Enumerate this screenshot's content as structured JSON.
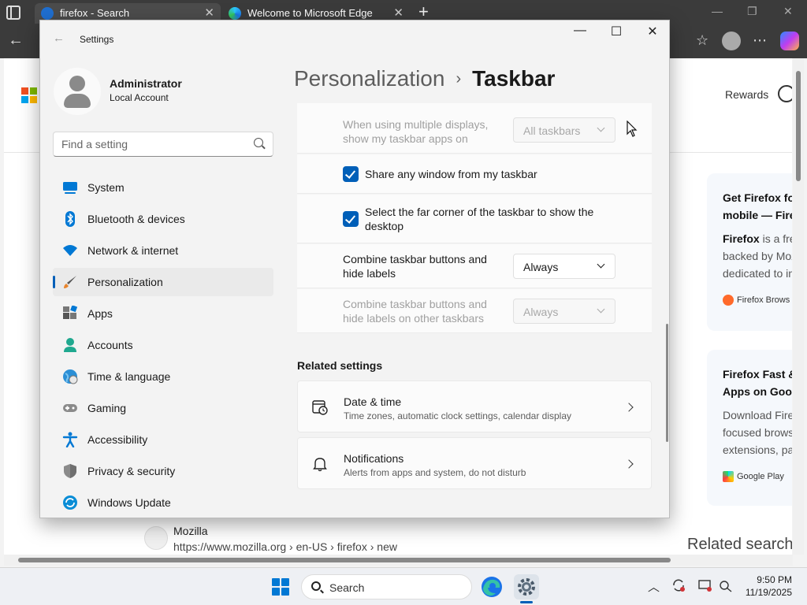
{
  "browser": {
    "tabs": [
      {
        "title": "firefox - Search",
        "active": true
      },
      {
        "title": "Welcome to Microsoft Edge",
        "active": false
      }
    ],
    "new_tab": "+",
    "rewards": "Rewards",
    "cards": [
      {
        "title_lines": [
          "Get Firefox for",
          "mobile — Firef"
        ],
        "body_bold": "Firefox",
        "body_lines": [
          " is a fre",
          "backed by Moz",
          "dedicated to in"
        ],
        "source": "Firefox Brows"
      },
      {
        "title_lines": [
          "Firefox Fast &",
          "Apps on Goog"
        ],
        "body_lines": [
          "Download Fire",
          "focused brows",
          "extensions, pa"
        ],
        "source": "Google Play"
      }
    ],
    "result": {
      "title": "Mozilla",
      "url": "https://www.mozilla.org › en-US › firefox › new"
    },
    "related_searches": "Related search"
  },
  "settings": {
    "window_title": "Settings",
    "account": {
      "name": "Administrator",
      "type": "Local Account"
    },
    "search_placeholder": "Find a setting",
    "nav": [
      {
        "label": "System",
        "icon": "system-icon",
        "active": false
      },
      {
        "label": "Bluetooth & devices",
        "icon": "bluetooth-icon",
        "active": false
      },
      {
        "label": "Network & internet",
        "icon": "wifi-icon",
        "active": false
      },
      {
        "label": "Personalization",
        "icon": "brush-icon",
        "active": true
      },
      {
        "label": "Apps",
        "icon": "apps-icon",
        "active": false
      },
      {
        "label": "Accounts",
        "icon": "accounts-icon",
        "active": false
      },
      {
        "label": "Time & language",
        "icon": "globe-icon",
        "active": false
      },
      {
        "label": "Gaming",
        "icon": "gamepad-icon",
        "active": false
      },
      {
        "label": "Accessibility",
        "icon": "accessibility-icon",
        "active": false
      },
      {
        "label": "Privacy & security",
        "icon": "shield-icon",
        "active": false
      },
      {
        "label": "Windows Update",
        "icon": "update-icon",
        "active": false
      }
    ],
    "breadcrumb": {
      "parent": "Personalization",
      "separator": "›",
      "current": "Taskbar"
    },
    "rows": {
      "multi_display": {
        "label_lines": [
          "When using multiple displays,",
          "show my taskbar apps on"
        ],
        "value": "All taskbars",
        "disabled": true
      },
      "share_window": {
        "label": "Share any window from my taskbar",
        "checked": true
      },
      "far_corner": {
        "label_lines": [
          "Select the far corner of the taskbar to show the",
          "desktop"
        ],
        "checked": true
      },
      "combine": {
        "label_lines": [
          "Combine taskbar buttons and",
          "hide labels"
        ],
        "value": "Always",
        "disabled": false
      },
      "combine_other": {
        "label_lines": [
          "Combine taskbar buttons and",
          "hide labels on other taskbars"
        ],
        "value": "Always",
        "disabled": true
      }
    },
    "related_heading": "Related settings",
    "related": [
      {
        "title": "Date & time",
        "subtitle": "Time zones, automatic clock settings, calendar display",
        "icon": "calendar-clock-icon"
      },
      {
        "title": "Notifications",
        "subtitle": "Alerts from apps and system, do not disturb",
        "icon": "bell-icon"
      }
    ]
  },
  "taskbar": {
    "search_label": "Search",
    "time": "9:50 PM",
    "date": "11/19/2025"
  },
  "colors": {
    "accent": "#005fb8",
    "windows_blue": "#0078d4"
  }
}
